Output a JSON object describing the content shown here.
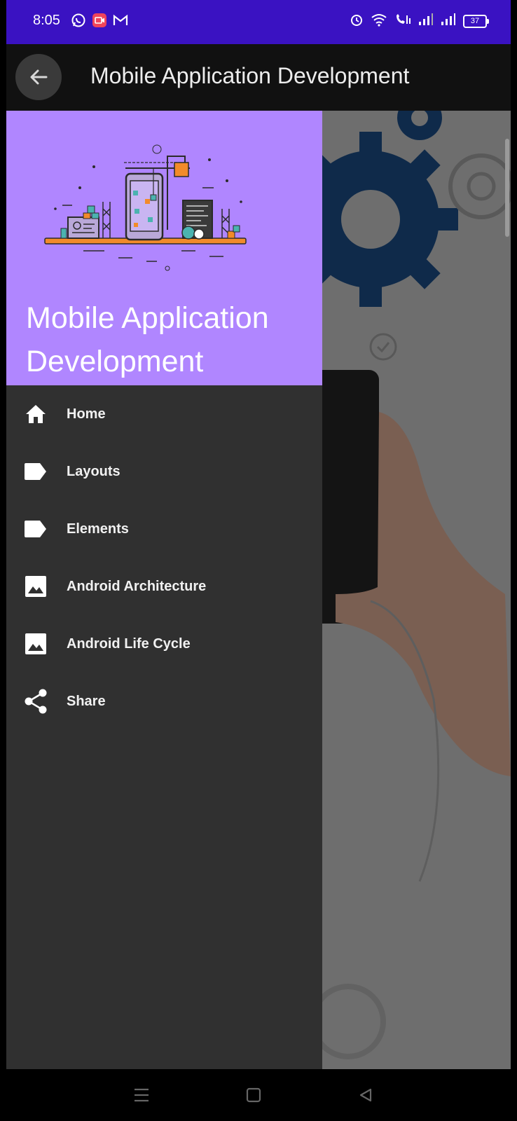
{
  "status_bar": {
    "time": "8:05",
    "battery": "37",
    "left_icons": [
      "whatsapp-icon",
      "screen-recorder-icon",
      "gmail-icon"
    ],
    "right_icons": [
      "alarm-icon",
      "wifi-icon",
      "volte-icon",
      "signal-icon",
      "signal-icon"
    ]
  },
  "toolbar": {
    "title": "Mobile Application Development",
    "back_icon": "arrow-left-icon"
  },
  "drawer": {
    "header_title": "Mobile Application Development",
    "menu": [
      {
        "label": "Home",
        "icon": "home-icon"
      },
      {
        "label": "Layouts",
        "icon": "label-icon"
      },
      {
        "label": "Elements",
        "icon": "label-icon"
      },
      {
        "label": "Android Architecture",
        "icon": "image-icon"
      },
      {
        "label": "Android Life Cycle",
        "icon": "image-icon"
      },
      {
        "label": "Share",
        "icon": "share-icon"
      }
    ]
  },
  "colors": {
    "status_bar": "#3a12c2",
    "toolbar": "#111111",
    "drawer_header": "#b086ff",
    "drawer_body": "#303030"
  },
  "nav_bar": [
    "menu-icon",
    "home-square-icon",
    "back-triangle-icon"
  ]
}
